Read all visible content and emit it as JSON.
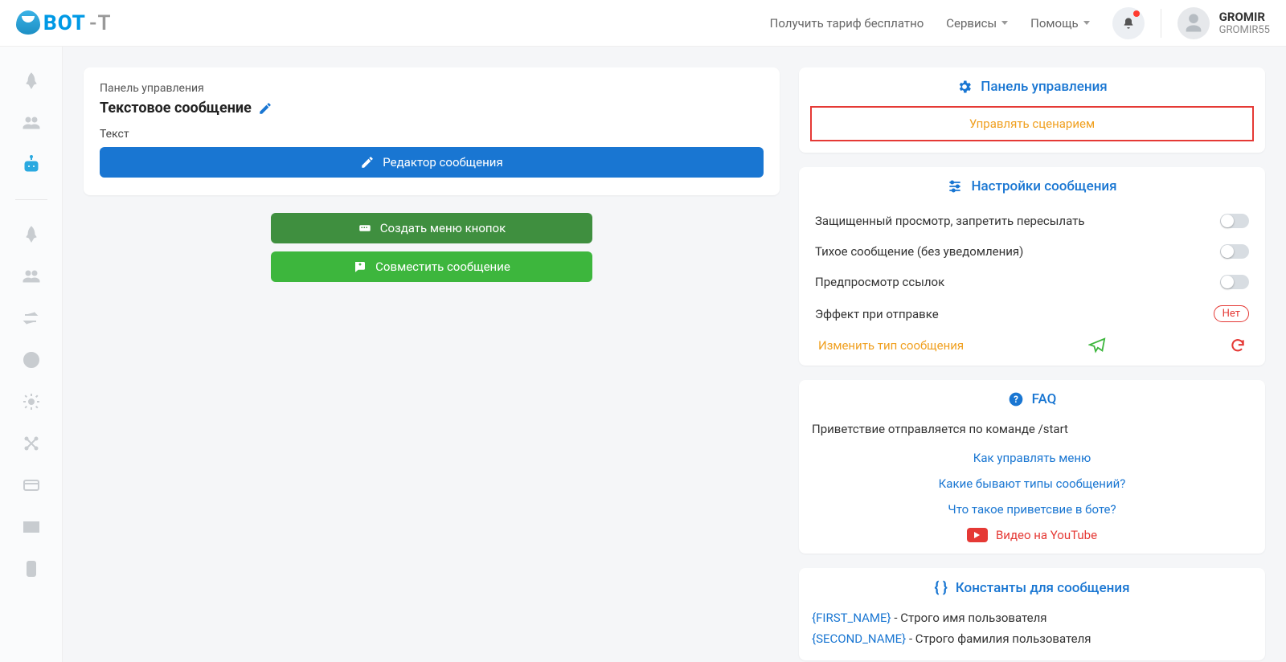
{
  "logo": {
    "t1": "BOT",
    "t2": "-T"
  },
  "header": {
    "tariff": "Получить тариф бесплатно",
    "services": "Сервисы",
    "help": "Помощь"
  },
  "user": {
    "name": "GROMIR",
    "sub": "GROMIR55"
  },
  "left": {
    "breadcrumb": "Панель управления",
    "title": "Текстовое сообщение",
    "text_label": "Текст",
    "editor_btn": "Редактор сообщения",
    "create_menu_btn": "Создать меню кнопок",
    "combine_btn": "Совместить сообщение"
  },
  "right": {
    "panel_header": "Панель управления",
    "manage_scenario": "Управлять сценарием",
    "settings_header": "Настройки сообщения",
    "settings": {
      "protected": "Защищенный просмотр, запретить пересылать",
      "silent": "Тихое сообщение (без уведомления)",
      "preview": "Предпросмотр ссылок",
      "effect": "Эффект при отправке",
      "effect_val": "Нет"
    },
    "change_type": "Изменить тип сообщения",
    "faq": {
      "header": "FAQ",
      "intro": "Приветствие отправляется по команде /start",
      "l1": "Как управлять меню",
      "l2": "Какие бывают типы сообщений?",
      "l3": "Что такое приветсвие в боте?",
      "yt": "Видео на YouTube"
    },
    "constants": {
      "header": "Константы для сообщения",
      "c1_key": "{FIRST_NAME}",
      "c1_desc": " - Строго имя пользователя",
      "c2_key": "{SECOND_NAME}",
      "c2_desc": " - Строго фамилия пользователя"
    }
  }
}
